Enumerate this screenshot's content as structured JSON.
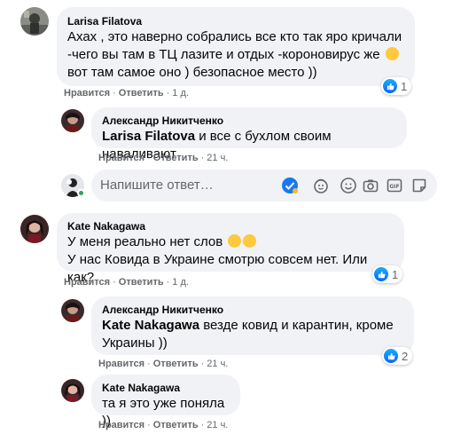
{
  "comments": [
    {
      "author": "Larisa Filatova",
      "lines": [
        "Ахах , это наверно собрались все кто так яро кричали",
        "-чего вы там в ТЦ лазите и отдых -короновирус же",
        "вот там самое оно ) безопасное место ))"
      ],
      "like": "Нравится",
      "reply": "Ответить",
      "time": "1 д.",
      "reaction_count": "1"
    },
    {
      "author": "Александр Никитченко",
      "mention": "Larisa Filatova",
      "text": " и все с бухлом своим наваливают",
      "like": "Нравится",
      "reply": "Ответить",
      "time": "21 ч."
    },
    {
      "author": "Kate Nakagawa",
      "lines": [
        "У меня реально нет слов",
        "У нас Ковида в Украине смотрю совсем нет. Или как?"
      ],
      "like": "Нравится",
      "reply": "Ответить",
      "time": "1 д.",
      "reaction_count": "1"
    },
    {
      "author": "Александр Никитченко",
      "mention": "Kate Nakagawa",
      "text": " везде ковид и карантин, кроме",
      "text2": "Украины ))",
      "like": "Нравится",
      "reply": "Ответить",
      "time": "21 ч.",
      "reaction_count": "2"
    },
    {
      "author": "Kate Nakagawa",
      "text": "та я это уже поняла ))",
      "like": "Нравится",
      "reply": "Ответить",
      "time": "21 ч."
    }
  ],
  "reply_box": {
    "placeholder": "Напишите ответ…"
  },
  "icons": [
    "like-icon",
    "check-icon",
    "gift-emoji-icon",
    "smiley-icon",
    "camera-icon",
    "gif-icon",
    "sticker-icon"
  ],
  "colors": {
    "bubble": "#f0f2f5",
    "meta_text": "#65676b",
    "like_blue": "#0866ff",
    "online_green": "#31a24c"
  }
}
